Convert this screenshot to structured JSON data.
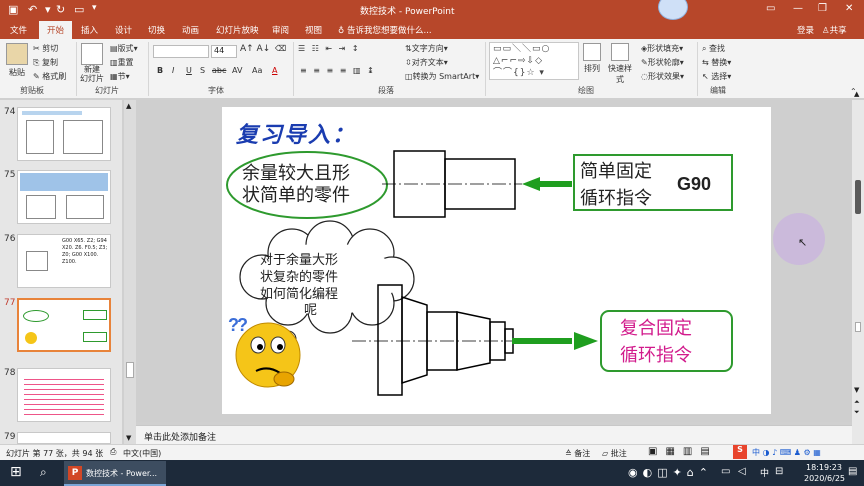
{
  "app": {
    "title": "数控技术 - PowerPoint",
    "account": "登录",
    "share": "共享",
    "tell_me": "告诉我您想要做什么..."
  },
  "tabs": [
    "文件",
    "开始",
    "插入",
    "设计",
    "切换",
    "动画",
    "幻灯片放映",
    "审阅",
    "视图"
  ],
  "active_tab": "开始",
  "ribbon": {
    "clipboard": {
      "paste": "粘贴",
      "cut": "剪切",
      "copy": "复制",
      "format_painter": "格式刷",
      "group": "剪贴板"
    },
    "slides": {
      "new_slide": "新建\n幻灯片",
      "layout": "版式",
      "reset": "重置",
      "section": "节",
      "group": "幻灯片"
    },
    "font": {
      "size": "44",
      "group": "字体",
      "buttons": [
        "B",
        "I",
        "U",
        "S",
        "abc",
        "AV",
        "Aa",
        "A"
      ]
    },
    "paragraph": {
      "text_direction": "文字方向",
      "align_text": "对齐文本",
      "smartart": "转换为 SmartArt",
      "group": "段落"
    },
    "drawing": {
      "arrange": "排列",
      "quick_styles": "快速样式",
      "shape_fill": "形状填充",
      "shape_outline": "形状轮廓",
      "shape_effects": "形状效果",
      "group": "绘图"
    },
    "editing": {
      "find": "查找",
      "replace": "替换",
      "select": "选择",
      "group": "编辑"
    }
  },
  "thumbnails": [
    {
      "num": "74",
      "selected": false
    },
    {
      "num": "75",
      "selected": false
    },
    {
      "num": "76",
      "selected": false,
      "text": "G00 X65. Z2; G94 X20. Z6. F0.5; Z3; Z0; G00 X100. Z100."
    },
    {
      "num": "77",
      "selected": true
    },
    {
      "num": "78",
      "selected": false
    },
    {
      "num": "79",
      "selected": false
    }
  ],
  "slide": {
    "heading": "复习导入：",
    "oval_text_line1": "余量较大且形",
    "oval_text_line2": "状简单的零件",
    "box1_line1": "简单固定",
    "box1_line2": "循环指令",
    "box1_code": "G90",
    "cloud_line1": "对于余量大形",
    "cloud_line2": "状复杂的零件",
    "cloud_line3": "如何简化编程",
    "cloud_line4": "呢",
    "box2_line1": "复合固定",
    "box2_line2": "循环指令",
    "question_marks": "??"
  },
  "notes_placeholder": "单击此处添加备注",
  "status": {
    "slide_info": "幻灯片 第 77 张，共 94 张",
    "language": "中文(中国)",
    "notes_btn": "备注",
    "comments_btn": "批注"
  },
  "taskbar": {
    "app_label": "数控技术 - Power...",
    "time": "18:19:23",
    "date": "2020/6/25",
    "ime": "中",
    "ime2": "中"
  },
  "colors": {
    "accent": "#b7472a",
    "green_border": "#2e9a2e",
    "magenta": "#d21b8c",
    "arrow_green": "#1f9e1f",
    "blue_title": "#1a3cb0"
  }
}
